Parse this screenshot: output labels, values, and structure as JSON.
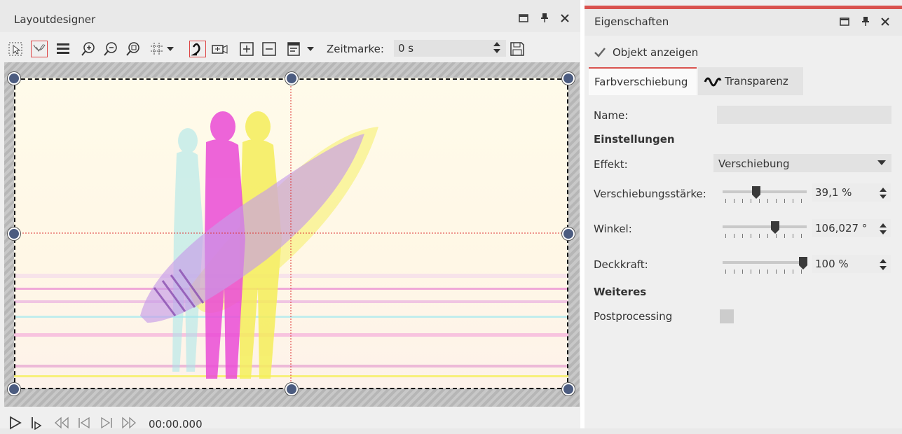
{
  "layoutdesigner": {
    "title": "Layoutdesigner",
    "zeitmarke_label": "Zeitmarke:",
    "zeitmarke_value": "0 s",
    "timecode": "00:00.000"
  },
  "properties": {
    "title": "Eigenschaften",
    "show_object_label": "Objekt anzeigen",
    "show_object_checked": true,
    "tabs": [
      {
        "label": "Farbverschiebung",
        "active": true
      },
      {
        "label": "Transparenz",
        "active": false
      }
    ],
    "name_label": "Name:",
    "name_value": "",
    "section_settings": "Einstellungen",
    "effect_label": "Effekt:",
    "effect_value": "Verschiebung",
    "strength_label": "Verschiebungsstärke:",
    "strength_value": "39,1 %",
    "strength_level": 0.391,
    "angle_label": "Winkel:",
    "angle_value": "106,027 °",
    "angle_level": 0.59,
    "opacity_label": "Deckkraft:",
    "opacity_value": "100 %",
    "opacity_level": 1.0,
    "section_more": "Weiteres",
    "postprocessing_label": "Postprocessing",
    "postprocessing_checked": false
  },
  "colors": {
    "accent": "#d9534f",
    "handle": "#4c5c80"
  }
}
